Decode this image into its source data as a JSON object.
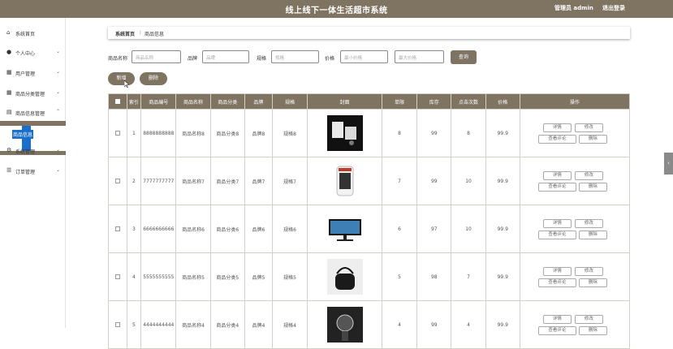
{
  "header": {
    "title": "线上线下一体生活超市系统",
    "admin": "管理员 admin",
    "logout": "退出登录"
  },
  "sidebar": {
    "items": [
      {
        "label": "系统首页",
        "icon": "home-icon"
      },
      {
        "label": "个人中心",
        "icon": "user-icon"
      },
      {
        "label": "用户管理",
        "icon": "grid-icon"
      },
      {
        "label": "商品分类管理",
        "icon": "grid-icon"
      },
      {
        "label": "商品信息管理",
        "icon": "doc-icon"
      },
      {
        "label": "系统管理",
        "icon": "gear-icon"
      },
      {
        "label": "订单管理",
        "icon": "sliders-icon"
      }
    ],
    "sub_item": "商品信息"
  },
  "breadcrumb": {
    "home": "系统首页",
    "sep": "⋮",
    "current": "商品信息"
  },
  "filters": {
    "name_label": "商品名称",
    "name_placeholder": "商品名称",
    "brand_label": "品牌",
    "brand_placeholder": "品牌",
    "spec_label": "规格",
    "spec_placeholder": "规格",
    "price_label": "价格",
    "min_placeholder": "最小价格",
    "max_placeholder": "最大价格",
    "search": "查询"
  },
  "actions": {
    "add": "新增",
    "delete": "删除"
  },
  "table": {
    "headers": [
      "索引",
      "商品编号",
      "商品名称",
      "商品分类",
      "品牌",
      "规格",
      "封面",
      "单限",
      "库存",
      "点击次数",
      "价格",
      "操作"
    ],
    "ops": {
      "detail": "详情",
      "edit": "修改",
      "review": "查看评论",
      "delete": "删除"
    },
    "rows": [
      {
        "index": "1",
        "code": "8888888888",
        "name": "商品名称8",
        "category": "商品分类8",
        "brand": "品牌8",
        "spec": "规格8",
        "cover": "product-photo",
        "limit": "8",
        "stock": "99",
        "clicks": "8",
        "price": "99.9"
      },
      {
        "index": "2",
        "code": "7777777777",
        "name": "商品名称7",
        "category": "商品分类7",
        "brand": "品牌7",
        "spec": "规格7",
        "cover": "heater-photo",
        "limit": "7",
        "stock": "99",
        "clicks": "10",
        "price": "99.9"
      },
      {
        "index": "3",
        "code": "6666666666",
        "name": "商品名称6",
        "category": "商品分类6",
        "brand": "品牌6",
        "spec": "规格6",
        "cover": "monitor-photo",
        "limit": "6",
        "stock": "97",
        "clicks": "10",
        "price": "99.9"
      },
      {
        "index": "4",
        "code": "5555555555",
        "name": "商品名称5",
        "category": "商品分类5",
        "brand": "品牌5",
        "spec": "规格5",
        "cover": "bag-photo",
        "limit": "5",
        "stock": "98",
        "clicks": "7",
        "price": "99.9"
      },
      {
        "index": "5",
        "code": "4444444444",
        "name": "商品名称4",
        "category": "商品分类4",
        "brand": "品牌4",
        "spec": "规格4",
        "cover": "watch-photo",
        "limit": "4",
        "stock": "99",
        "clicks": "4",
        "price": "99.9"
      }
    ]
  },
  "colors": {
    "accent": "#7f7462",
    "highlight": "#1a6fc9"
  }
}
